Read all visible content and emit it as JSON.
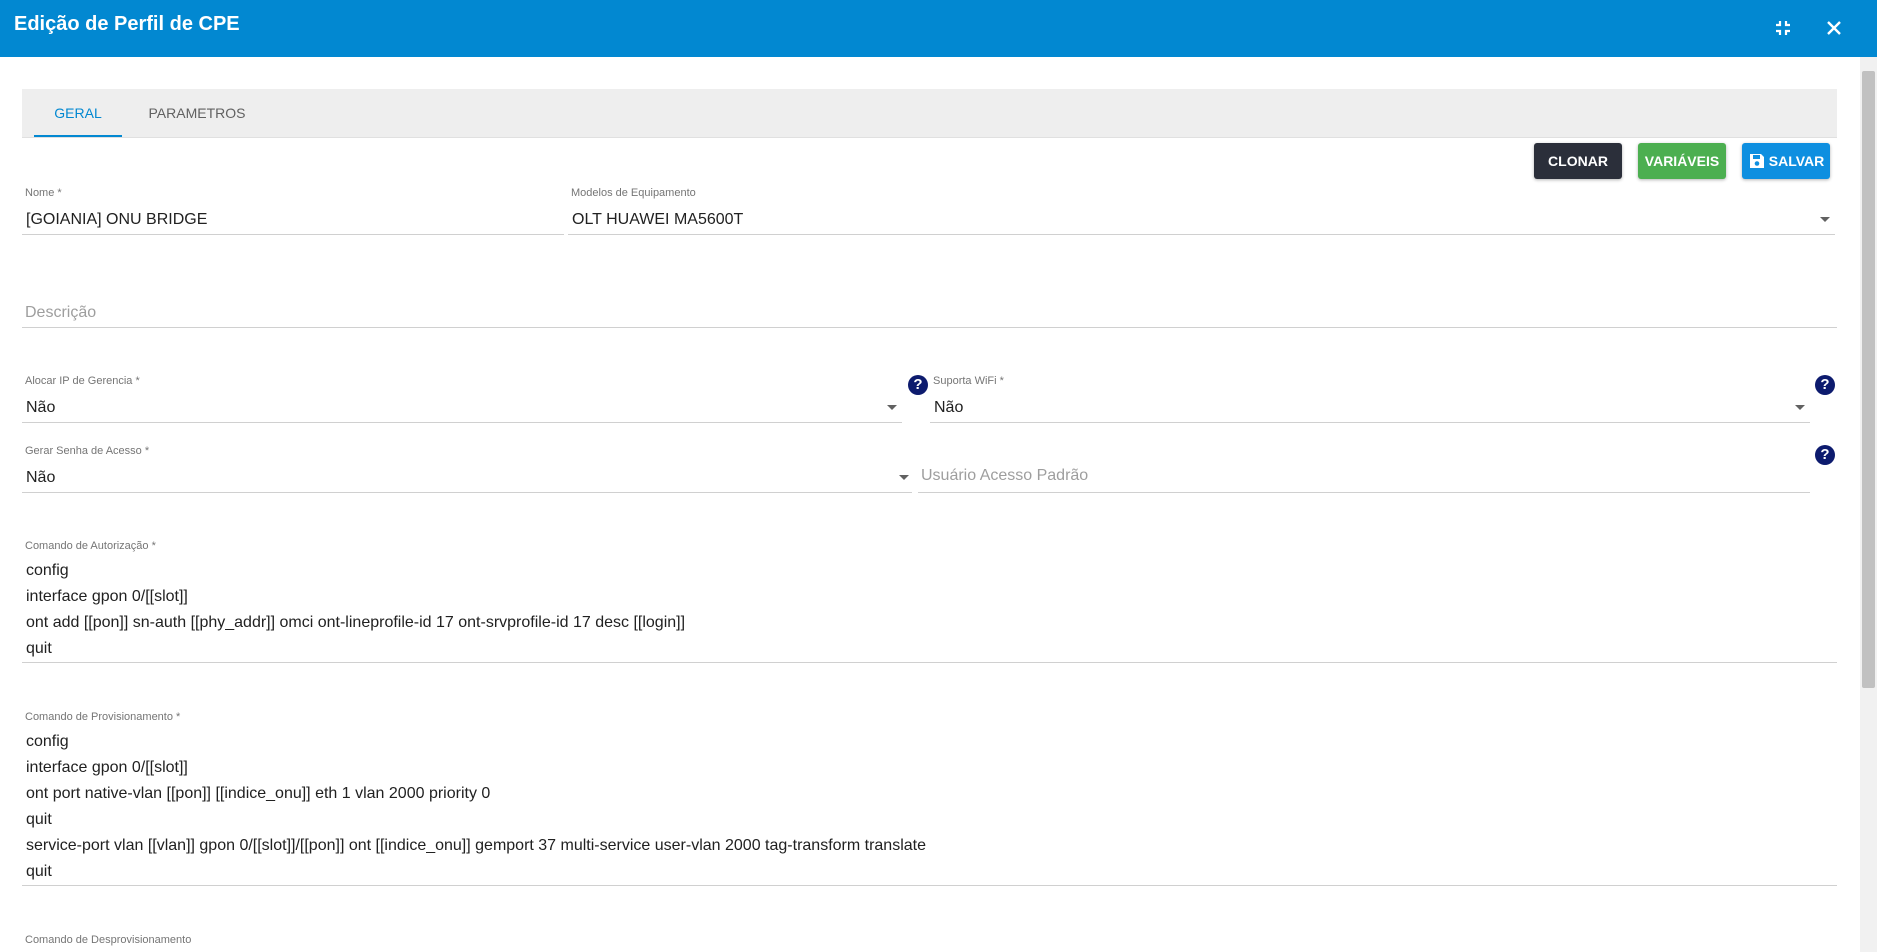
{
  "window": {
    "title": "Edição de Perfil de CPE",
    "minimize_icon": "compress-icon",
    "close_icon": "close-icon"
  },
  "tabs": [
    {
      "label": "GERAL",
      "active": true
    },
    {
      "label": "PARAMETROS",
      "active": false
    }
  ],
  "toolbar": {
    "clone_label": "CLONAR",
    "variables_label": "VARIÁVEIS",
    "save_label": "SALVAR",
    "colors": {
      "clone": "#2b2f3a",
      "variables": "#4caf50",
      "save": "#0e8fe0"
    }
  },
  "form": {
    "nome": {
      "label": "Nome *",
      "value": "[GOIANIA] ONU BRIDGE"
    },
    "modelos": {
      "label": "Modelos de Equipamento",
      "value": "OLT HUAWEI MA5600T"
    },
    "descricao": {
      "placeholder": "Descrição"
    },
    "alocar_ip": {
      "label": "Alocar IP de Gerencia *",
      "value": "Não"
    },
    "suporta_wifi": {
      "label": "Suporta WiFi *",
      "value": "Não"
    },
    "gerar_senha": {
      "label": "Gerar Senha de Acesso *",
      "value": "Não"
    },
    "usuario_acesso": {
      "placeholder": "Usuário Acesso Padrão"
    },
    "comando_autorizacao": {
      "label": "Comando de Autorização *",
      "lines": [
        "config",
        "interface gpon 0/[[slot]]",
        "ont add [[pon]] sn-auth [[phy_addr]] omci ont-lineprofile-id 17 ont-srvprofile-id 17 desc [[login]]",
        "quit"
      ]
    },
    "comando_provisionamento": {
      "label": "Comando de Provisionamento *",
      "lines": [
        "config",
        "interface gpon 0/[[slot]]",
        "ont port native-vlan [[pon]] [[indice_onu]] eth 1 vlan 2000 priority 0",
        "quit",
        "service-port vlan [[vlan]] gpon 0/[[slot]]/[[pon]] ont [[indice_onu]] gemport 37 multi-service user-vlan 2000 tag-transform translate",
        "quit"
      ]
    },
    "comando_desprovisionamento": {
      "label": "Comando de Desprovisionamento"
    }
  },
  "help_icon": "?",
  "accent_color": "#0288d1"
}
